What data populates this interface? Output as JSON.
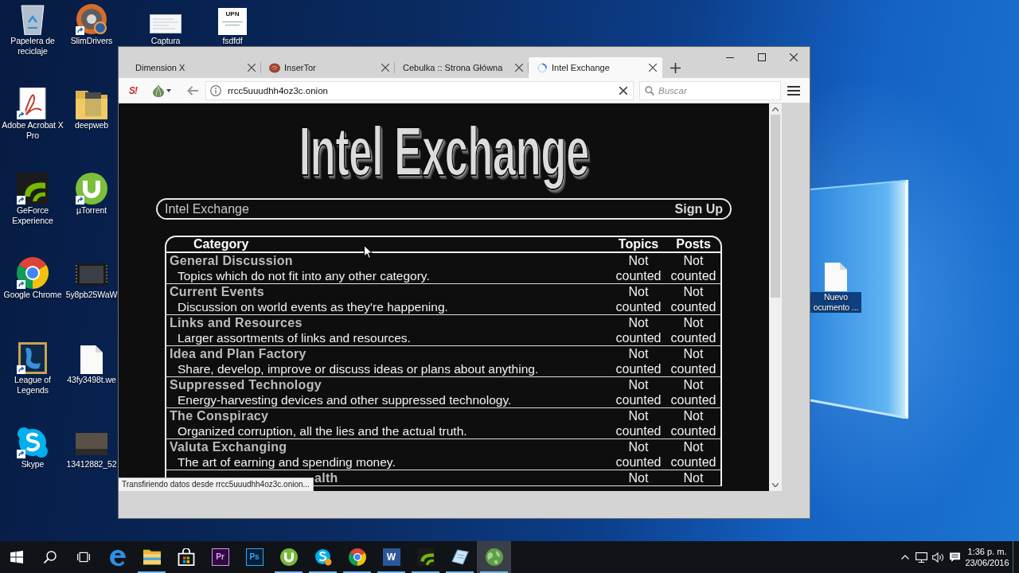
{
  "desktop": {
    "columns": [
      [
        {
          "label": "Papelera de reciclaje",
          "shortcut": false,
          "selected": false
        },
        {
          "label": "Adobe Acrobat X Pro",
          "shortcut": true,
          "selected": false
        },
        {
          "label": "GeForce Experience",
          "shortcut": true,
          "selected": false
        },
        {
          "label": "Google Chrome",
          "shortcut": true,
          "selected": false
        },
        {
          "label": "League of Legends",
          "shortcut": true,
          "selected": false
        },
        {
          "label": "Skype",
          "shortcut": true,
          "selected": false
        }
      ],
      [
        {
          "label": "SlimDrivers",
          "shortcut": true,
          "selected": false
        },
        {
          "label": "deepweb",
          "shortcut": false,
          "selected": false
        },
        {
          "label": "µTorrent",
          "shortcut": true,
          "selected": false
        },
        {
          "label": "5y8pb25WaW",
          "shortcut": false,
          "selected": false
        },
        {
          "label": "43fy3498t.we",
          "shortcut": false,
          "selected": false
        },
        {
          "label": "13412882_52",
          "shortcut": false,
          "selected": false
        }
      ],
      [
        {
          "label": "Captura",
          "shortcut": false,
          "selected": false
        }
      ],
      [
        {
          "label": "fsdfdf",
          "preview_text": "UPN",
          "shortcut": false,
          "selected": false
        }
      ]
    ],
    "right_icons": [
      {
        "label": "Nuevo ocumento ...",
        "shortcut": false,
        "selected": true
      }
    ]
  },
  "browser": {
    "tabs": [
      {
        "title": "Dimension X",
        "kind": "plain",
        "selected": false
      },
      {
        "title": "InserTor",
        "kind": "favicon",
        "selected": false
      },
      {
        "title": "Cebulka :: Strona Główna",
        "kind": "plain",
        "selected": false
      },
      {
        "title": "Intel Exchange",
        "kind": "loading",
        "selected": true
      }
    ],
    "addon_logo": "S!",
    "url": "rrcc5uuudhh4oz3c.onion",
    "search": {
      "placeholder": "Buscar"
    },
    "page": {
      "logo": "Intel Exchange",
      "nav": {
        "title": "Intel Exchange",
        "link": "Sign Up"
      },
      "table": {
        "columns": [
          "Category",
          "Topics",
          "Posts"
        ],
        "rows": [
          {
            "name": "General Discussion",
            "description": "Topics which do not fit into any other category.",
            "topics": "Not counted",
            "posts": "Not counted"
          },
          {
            "name": "Current Events",
            "description": "Discussion on world events as they're happening.",
            "topics": "Not counted",
            "posts": "Not counted"
          },
          {
            "name": "Links and Resources",
            "description": "Larger assortments of links and resources.",
            "topics": "Not counted",
            "posts": "Not counted"
          },
          {
            "name": "Idea and Plan Factory",
            "description": "Share, develop, improve or discuss ideas or plans about anything.",
            "topics": "Not counted",
            "posts": "Not counted"
          },
          {
            "name": "Suppressed Technology",
            "description": "Energy-harvesting devices and other suppressed technology.",
            "topics": "Not counted",
            "posts": "Not counted"
          },
          {
            "name": "The Conspiracy",
            "description": "Organized corruption, all the lies and the actual truth.",
            "topics": "Not counted",
            "posts": "Not counted"
          },
          {
            "name": "Valuta Exchanging",
            "description": "The art of earning and spending money.",
            "topics": "Not counted",
            "posts": "Not counted"
          },
          {
            "name": "alth",
            "topics": "Not",
            "posts": "Not"
          }
        ]
      }
    },
    "status": "Transfiriendo datos desde rrcc5uuudhh4oz3c.onion..."
  },
  "taskbar": {
    "apps": [
      {
        "running": false,
        "selected": false
      },
      {
        "running": true,
        "selected": false
      },
      {
        "running": false,
        "selected": false
      },
      {
        "glyph": "Pr",
        "running": false,
        "selected": false
      },
      {
        "glyph": "Ps",
        "running": false,
        "selected": false
      },
      {
        "running": true,
        "selected": false
      },
      {
        "running": true,
        "selected": false
      },
      {
        "running": true,
        "selected": false
      },
      {
        "glyph": "W",
        "running": true,
        "selected": false
      },
      {
        "running": true,
        "selected": false
      },
      {
        "running": true,
        "selected": false
      },
      {
        "running": true,
        "selected": true
      }
    ],
    "clock": {
      "time": "1:36 p. m.",
      "date": "23/06/2016"
    }
  }
}
